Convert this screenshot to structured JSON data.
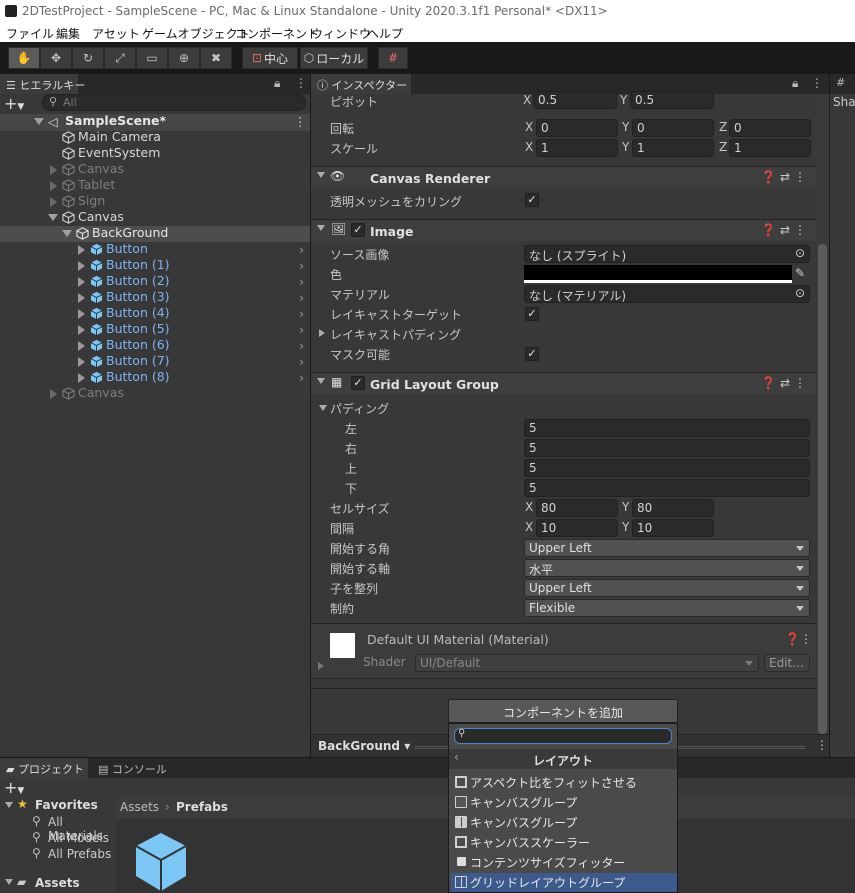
{
  "window": {
    "title": "2DTestProject - SampleScene - PC, Mac & Linux Standalone - Unity 2020.3.1f1 Personal* <DX11>"
  },
  "menu": [
    "ファイル",
    "編集",
    "アセット",
    "ゲームオブジェクト",
    "コンポーネント",
    "ウィンドウ",
    "ヘルプ"
  ],
  "toolbar": {
    "pivot_label": "中心",
    "space_label": "ローカル"
  },
  "hierarchy": {
    "tab": "ヒエラルキー",
    "search_placeholder": "All",
    "scene": "SampleScene*",
    "items": [
      "Main Camera",
      "EventSystem",
      "Canvas",
      "Tablet",
      "Sign",
      "Canvas",
      "BackGround",
      "Button",
      "Button (1)",
      "Button (2)",
      "Button (3)",
      "Button (4)",
      "Button (5)",
      "Button (6)",
      "Button (7)",
      "Button (8)",
      "Canvas"
    ]
  },
  "inspector": {
    "tab": "インスペクター",
    "pivot": {
      "label": "ピボット",
      "x": "0.5",
      "y": "0.5"
    },
    "rotation": {
      "label": "回転",
      "x": "0",
      "y": "0",
      "z": "0"
    },
    "scale": {
      "label": "スケール",
      "x": "1",
      "y": "1",
      "z": "1"
    },
    "axis": {
      "x": "X",
      "y": "Y",
      "z": "Z"
    },
    "canvas_renderer": {
      "title": "Canvas Renderer",
      "cull_label": "透明メッシュをカリング"
    },
    "image": {
      "title": "Image",
      "source_label": "ソース画像",
      "source_value": "なし (スプライト)",
      "color_label": "色",
      "material_label": "マテリアル",
      "material_value": "なし (マテリアル)",
      "raycast_target_label": "レイキャストターゲット",
      "raycast_padding_label": "レイキャストパディング",
      "maskable_label": "マスク可能"
    },
    "grid": {
      "title": "Grid Layout Group",
      "padding_label": "パディング",
      "left_label": "左",
      "left": "5",
      "right_label": "右",
      "right": "5",
      "top_label": "上",
      "top": "5",
      "bottom_label": "下",
      "bottom": "5",
      "cell_size_label": "セルサイズ",
      "cell_x": "80",
      "cell_y": "80",
      "spacing_label": "間隔",
      "spacing_x": "10",
      "spacing_y": "10",
      "start_corner_label": "開始する角",
      "start_corner": "Upper Left",
      "start_axis_label": "開始する軸",
      "start_axis": "水平",
      "child_align_label": "子を整列",
      "child_align": "Upper Left",
      "constraint_label": "制約",
      "constraint": "Flexible"
    },
    "material": {
      "title": "Default UI Material (Material)",
      "shader_label": "Shader",
      "shader_value": "UI/Default",
      "edit_label": "Edit..."
    },
    "add_component": "コンポーネントを追加",
    "footer_object": "BackGround"
  },
  "right_panel": {
    "tab": "Sha"
  },
  "project": {
    "tab_project": "プロジェクト",
    "tab_console": "コンソール",
    "favorites": "Favorites",
    "fav_items": [
      "All Materials",
      "All Models",
      "All Prefabs"
    ],
    "assets": "Assets",
    "breadcrumb": [
      "Assets",
      "Prefabs"
    ]
  },
  "popup": {
    "category": "レイアウト",
    "items": [
      "アスペクト比をフィットさせる",
      "キャンバスグループ",
      "キャンバスグループ",
      "キャンバススケーラー",
      "コンテンツサイズフィッター",
      "グリッドレイアウトグループ"
    ]
  },
  "colors": {
    "accent": "#7cb3f0",
    "selected": "#2c5d87",
    "popup_selected": "#3d5a8c",
    "icon_blue": "#7cc6f5"
  }
}
